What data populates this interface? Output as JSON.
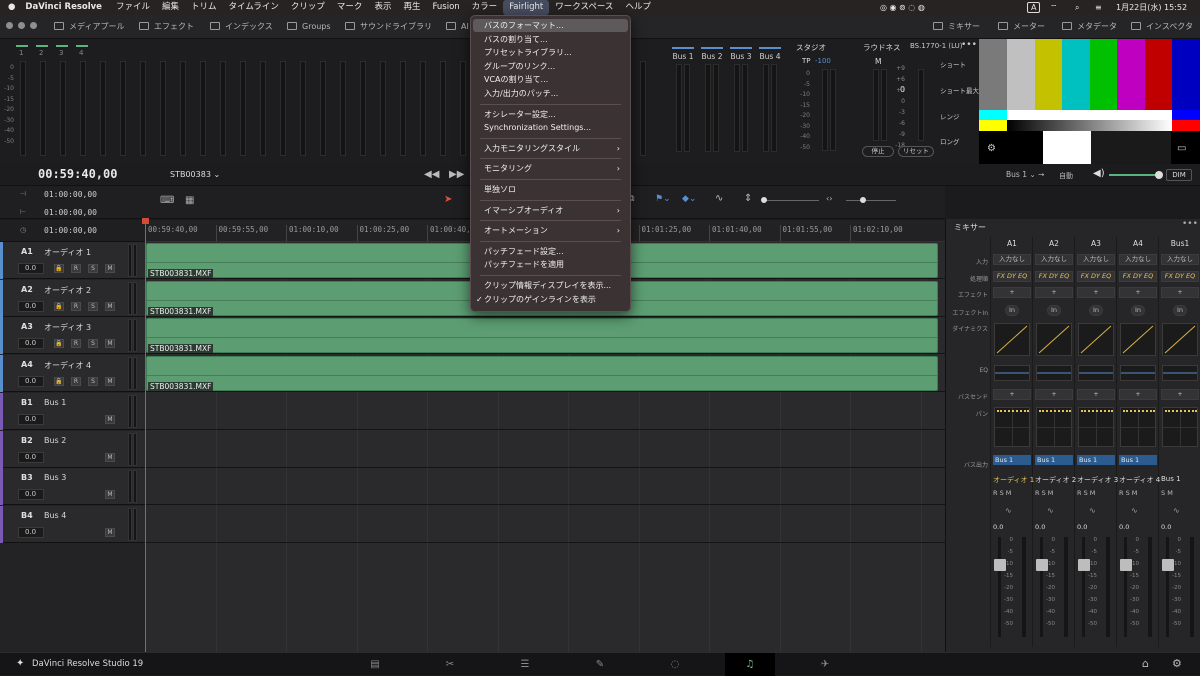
{
  "menubar": {
    "app": "DaVinci Resolve",
    "items": [
      "ファイル",
      "編集",
      "トリム",
      "タイムライン",
      "クリップ",
      "マーク",
      "表示",
      "再生",
      "Fusion",
      "カラー",
      "Fairlight",
      "ワークスペース",
      "ヘルプ"
    ],
    "active": "Fairlight",
    "input_indicator": "A",
    "clock": "1月22日(水) 15:52"
  },
  "toolbar": {
    "left": [
      "メディアプール",
      "エフェクト",
      "インデックス",
      "Groups",
      "サウンドライブラリ",
      "AI"
    ],
    "right": [
      "ミキサー",
      "メーター",
      "メタデータ",
      "インスペクタ"
    ]
  },
  "meters": {
    "channels": [
      "1",
      "2",
      "3",
      "4"
    ],
    "scale": [
      "0",
      "-5",
      "-10",
      "-15",
      "-20",
      "-30",
      "-40",
      "-50"
    ],
    "busses": [
      "Bus 1",
      "Bus 2",
      "Bus 3",
      "Bus 4"
    ],
    "studio_label": "スタジオ",
    "tp_label": "TP",
    "tp_value": "-100",
    "loudness_label": "ラウドネス",
    "loudness_std": "BS.1770-1 (LU)",
    "m_label": "M",
    "loudness_scale": [
      "+9",
      "+6",
      "+3",
      "0",
      "-3",
      "-6",
      "-9",
      "-18"
    ],
    "readout": "0",
    "readings": [
      "ショート",
      "ショート最大",
      "レンジ",
      "ロング"
    ],
    "stop_btn": "停止",
    "reset_btn": "リセット"
  },
  "transport": {
    "timecode": "00:59:40,00",
    "clip": "STB00383",
    "bus_select": "Bus 1",
    "auto": "自動",
    "dim": "DIM"
  },
  "timeline": {
    "tc_rows": [
      "01:00:00,00",
      "01:00:00,00",
      "01:00:00,00"
    ],
    "ticks": [
      "00:59:40,00",
      "00:59:55,00",
      "01:00:10,00",
      "01:00:25,00",
      "01:00:40,00",
      "01:00:55,00",
      "01:01:10,00",
      "01:01:25,00",
      "01:01:40,00",
      "01:01:55,00",
      "01:02:10,00"
    ],
    "clip_name": "STB003831.MXF"
  },
  "tracks": [
    {
      "id": "A1",
      "name": "オーディオ 1",
      "vol": "0.0",
      "type": "audio"
    },
    {
      "id": "A2",
      "name": "オーディオ 2",
      "vol": "0.0",
      "type": "audio"
    },
    {
      "id": "A3",
      "name": "オーディオ 3",
      "vol": "0.0",
      "type": "audio"
    },
    {
      "id": "A4",
      "name": "オーディオ 4",
      "vol": "0.0",
      "type": "audio"
    },
    {
      "id": "B1",
      "name": "Bus 1",
      "vol": "0.0",
      "type": "bus"
    },
    {
      "id": "B2",
      "name": "Bus 2",
      "vol": "0.0",
      "type": "bus"
    },
    {
      "id": "B3",
      "name": "Bus 3",
      "vol": "0.0",
      "type": "bus"
    },
    {
      "id": "B4",
      "name": "Bus 4",
      "vol": "0.0",
      "type": "bus"
    }
  ],
  "mixer": {
    "title": "ミキサー",
    "columns": [
      "A1",
      "A2",
      "A3",
      "A4",
      "Bus1"
    ],
    "rows": {
      "input": "入力",
      "fx": "処理順",
      "effects": "エフェクト",
      "effects_in": "エフェクトIn",
      "dynamics": "ダイナミクス",
      "eq": "EQ",
      "bus_send": "バスセンド",
      "pan": "パン",
      "bus_out": "バス出力"
    },
    "input_value": "入力なし",
    "fx_value": "FX DY EQ",
    "bus_out_value": "Bus 1",
    "channel_names": [
      "オーディオ 1",
      "オーディオ 2",
      "オーディオ 3",
      "オーディオ 4",
      "Bus 1"
    ],
    "fader_value": "0.0",
    "fader_scale": [
      "0",
      "-5",
      "-10",
      "-15",
      "-20",
      "-30",
      "-40",
      "-50"
    ]
  },
  "dropdown": {
    "items": [
      {
        "label": "バスのフォーマット...",
        "hi": true
      },
      {
        "label": "バスの割り当て..."
      },
      {
        "label": "プリセットライブラリ..."
      },
      {
        "label": "グループのリンク..."
      },
      {
        "label": "VCAの割り当て..."
      },
      {
        "label": "入力/出力のパッチ..."
      },
      {
        "sep": true
      },
      {
        "label": "オシレーター設定..."
      },
      {
        "label": "Synchronization Settings..."
      },
      {
        "sep": true
      },
      {
        "label": "入力モニタリングスタイル",
        "sub": true
      },
      {
        "sep": true
      },
      {
        "label": "モニタリング",
        "sub": true
      },
      {
        "sep": true
      },
      {
        "label": "単独ソロ"
      },
      {
        "sep": true
      },
      {
        "label": "イマーシブオーディオ",
        "sub": true
      },
      {
        "sep": true
      },
      {
        "label": "オートメーション",
        "sub": true
      },
      {
        "sep": true
      },
      {
        "label": "パッチフェード設定..."
      },
      {
        "label": "パッチフェードを適用"
      },
      {
        "sep": true
      },
      {
        "label": "クリップ情報ディスプレイを表示..."
      },
      {
        "label": "クリップのゲインラインを表示",
        "checked": true
      }
    ]
  },
  "pagebar": {
    "brand": "DaVinci Resolve Studio 19",
    "pages": [
      "media",
      "cut",
      "edit",
      "fusion",
      "color",
      "fairlight",
      "deliver"
    ],
    "active": "fairlight"
  },
  "colors": {
    "clip": "#5c9e72",
    "accent": "#5a8fce",
    "playhead": "#d24a3a",
    "fairlight": "#7fc78f"
  }
}
